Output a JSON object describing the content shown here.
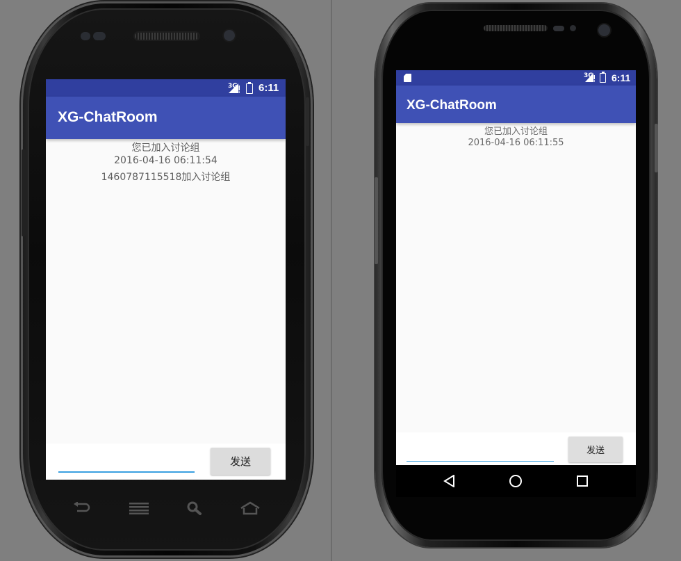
{
  "phone_a": {
    "status_bar": {
      "network": "3G",
      "time": "6:11"
    },
    "app_title": "XG-ChatRoom",
    "messages": [
      "您已加入讨论组",
      "2016-04-16 06:11:54",
      "1460787115518加入讨论组"
    ],
    "input": {
      "value": "",
      "placeholder": ""
    },
    "send_button": "发送",
    "hardware_keys": [
      "back-icon",
      "menu-icon",
      "search-icon",
      "home-icon"
    ]
  },
  "phone_b": {
    "status_bar": {
      "network": "3G",
      "time": "6:11",
      "notification_icon": "sdcard-icon"
    },
    "app_title": "XG-ChatRoom",
    "messages": [
      "您已加入讨论组",
      "2016-04-16 06:11:55"
    ],
    "input": {
      "value": "",
      "placeholder": ""
    },
    "send_button": "发送",
    "nav_buttons": [
      "back-triangle-icon",
      "home-circle-icon",
      "recents-square-icon"
    ]
  },
  "colors": {
    "primary": "#3f51b5",
    "primary_dark": "#303f9f",
    "accent": "#3aa0e0",
    "background": "#fafafa"
  }
}
